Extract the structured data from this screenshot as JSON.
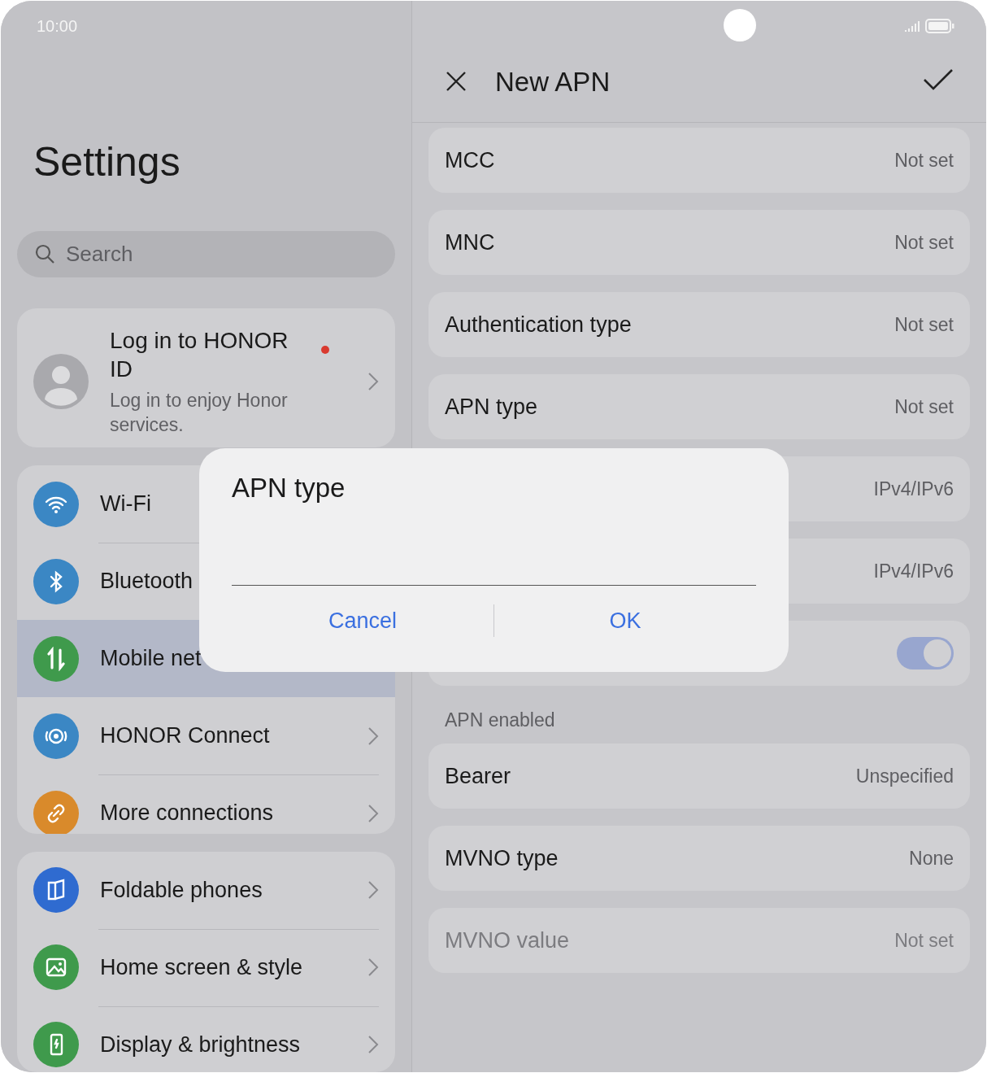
{
  "status_bar": {
    "time": "10:00"
  },
  "settings": {
    "title": "Settings",
    "search": {
      "placeholder": "Search"
    },
    "account": {
      "title": "Log in to HONOR ID",
      "subtitle": "Log in to enjoy Honor services.",
      "notification": true
    },
    "groups": [
      {
        "items": [
          {
            "label": "Wi-Fi",
            "color": "#3b87c4",
            "selected": false,
            "chevron": false
          },
          {
            "label": "Bluetooth",
            "color": "#3b87c4",
            "selected": false,
            "chevron": false
          },
          {
            "label": "Mobile net",
            "color": "#3f9a4c",
            "selected": true,
            "chevron": false
          },
          {
            "label": "HONOR Connect",
            "color": "#3b87c4",
            "selected": false,
            "chevron": true
          },
          {
            "label": "More connections",
            "color": "#d98a2b",
            "selected": false,
            "chevron": true
          }
        ]
      },
      {
        "items": [
          {
            "label": "Foldable phones",
            "color": "#2f6bd0",
            "selected": false,
            "chevron": true
          },
          {
            "label": "Home screen & style",
            "color": "#3f9a4c",
            "selected": false,
            "chevron": true
          },
          {
            "label": "Display & brightness",
            "color": "#3f9a4c",
            "selected": false,
            "chevron": true
          }
        ]
      }
    ]
  },
  "apn": {
    "title": "New APN",
    "rows": [
      {
        "kind": "value",
        "label": "MCC",
        "value": "Not set",
        "disabled": false
      },
      {
        "kind": "value",
        "label": "MNC",
        "value": "Not set",
        "disabled": false
      },
      {
        "kind": "value",
        "label": "Authentication type",
        "value": "Not set",
        "disabled": false
      },
      {
        "kind": "value",
        "label": "APN type",
        "value": "Not set",
        "disabled": false
      },
      {
        "kind": "value",
        "value": "IPv4/IPv6",
        "disabled": false
      },
      {
        "kind": "value",
        "value": "IPv4/IPv6",
        "disabled": false
      },
      {
        "kind": "toggle",
        "on": true,
        "caption": "APN enabled"
      },
      {
        "kind": "value",
        "label": "Bearer",
        "value": "Unspecified",
        "disabled": false
      },
      {
        "kind": "value",
        "label": "MVNO type",
        "value": "None",
        "disabled": false
      },
      {
        "kind": "value",
        "label": "MVNO value",
        "value": "Not set",
        "disabled": true
      }
    ]
  },
  "dialog": {
    "title": "APN type",
    "buttons": [
      "Cancel",
      "OK"
    ]
  }
}
